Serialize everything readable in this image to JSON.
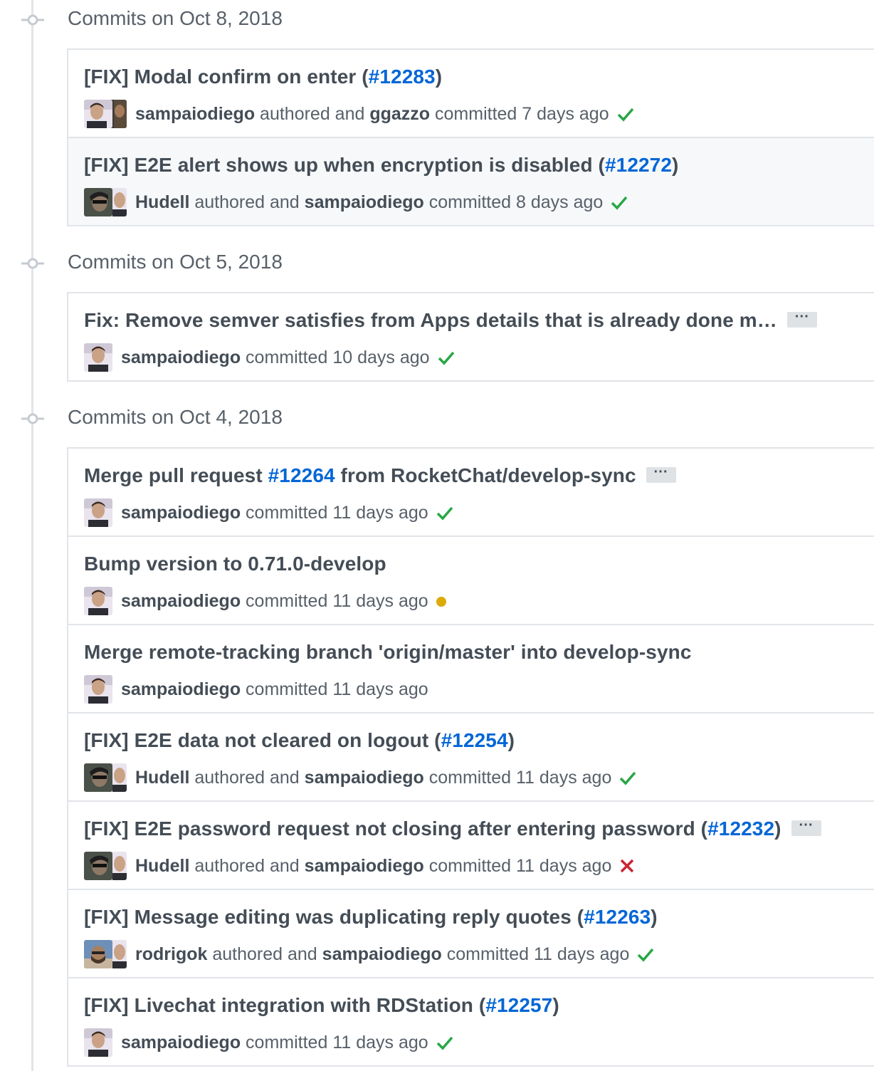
{
  "groups": [
    {
      "title": "Commits on Oct 8, 2018",
      "commits": [
        {
          "title_prefix": "[FIX] Modal confirm on enter (",
          "pr": "#12283",
          "title_suffix": ")",
          "author": "sampaiodiego",
          "mid": "authored and",
          "committer": "ggazzo",
          "action": "committed",
          "time": "7 days ago",
          "status": "success"
        },
        {
          "title_prefix": "[FIX] E2E alert shows up when encryption is disabled (",
          "pr": "#12272",
          "title_suffix": ")",
          "author": "Hudell",
          "mid": "authored and",
          "committer": "sampaiodiego",
          "action": "committed",
          "time": "8 days ago",
          "status": "success"
        }
      ]
    },
    {
      "title": "Commits on Oct 5, 2018",
      "commits": [
        {
          "title_prefix": "Fix: Remove semver satisfies from Apps details that is already done m…",
          "author": "sampaiodiego",
          "action": "committed",
          "time": "10 days ago",
          "status": "success",
          "ellipsis": "···"
        }
      ]
    },
    {
      "title": "Commits on Oct 4, 2018",
      "commits": [
        {
          "title_prefix": "Merge pull request ",
          "pr": "#12264",
          "title_suffix": " from RocketChat/develop-sync",
          "author": "sampaiodiego",
          "action": "committed",
          "time": "11 days ago",
          "status": "success",
          "ellipsis": "···"
        },
        {
          "title_prefix": "Bump version to 0.71.0-develop",
          "author": "sampaiodiego",
          "action": "committed",
          "time": "11 days ago",
          "status": "pending"
        },
        {
          "title_prefix": "Merge remote-tracking branch 'origin/master' into develop-sync",
          "author": "sampaiodiego",
          "action": "committed",
          "time": "11 days ago",
          "status": "none"
        },
        {
          "title_prefix": "[FIX] E2E data not cleared on logout (",
          "pr": "#12254",
          "title_suffix": ")",
          "author": "Hudell",
          "mid": "authored and",
          "committer": "sampaiodiego",
          "action": "committed",
          "time": "11 days ago",
          "status": "success"
        },
        {
          "title_prefix": "[FIX] E2E password request not closing after entering password (",
          "pr": "#12232",
          "title_suffix": ")",
          "author": "Hudell",
          "mid": "authored and",
          "committer": "sampaiodiego",
          "action": "committed",
          "time": "11 days ago",
          "status": "failure",
          "ellipsis": "···"
        },
        {
          "title_prefix": "[FIX] Message editing was duplicating reply quotes (",
          "pr": "#12263",
          "title_suffix": ")",
          "author": "rodrigok",
          "mid": "authored and",
          "committer": "sampaiodiego",
          "action": "committed",
          "time": "11 days ago",
          "status": "success"
        },
        {
          "title_prefix": "[FIX] Livechat integration with RDStation (",
          "pr": "#12257",
          "title_suffix": ")",
          "author": "sampaiodiego",
          "action": "committed",
          "time": "11 days ago",
          "status": "success"
        }
      ]
    }
  ],
  "colors": {
    "success": "#28a745",
    "pending": "#dbab09",
    "failure": "#cb2431",
    "link": "#0366d6"
  }
}
